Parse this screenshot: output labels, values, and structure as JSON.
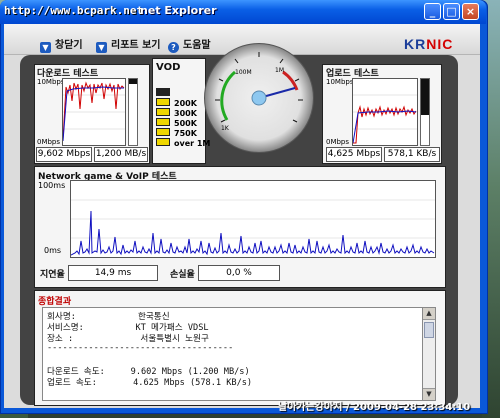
{
  "window": {
    "url_title": "http://www.bcpark.net",
    "app_title": "net Explorer",
    "minimize": "_",
    "maximize": "□",
    "close": "×"
  },
  "toolbar": {
    "close_label": "창닫기",
    "report_label": "리포트 보기",
    "help_label": "도움말",
    "brand_prefix": "KR",
    "brand_suffix": "NIC"
  },
  "download": {
    "title": "다운로드 테스트",
    "ymax": "10Mbps",
    "ymin": "0Mbps",
    "speed_mbps": "9,602 Mbps",
    "speed_mbs": "1,200 MB/s",
    "level": 0.92
  },
  "upload": {
    "title": "업로드 테스트",
    "ymax": "10Mbps",
    "ymin": "0Mbps",
    "speed_mbps": "4,625 Mbps",
    "speed_kbs": "578,1 KB/s",
    "level": 0.45
  },
  "vod": {
    "title": "VOD",
    "items": [
      "200K",
      "300K",
      "500K",
      "750K",
      "over 1M"
    ]
  },
  "gauge": {
    "labels": [
      "100M",
      "1M",
      "1K"
    ]
  },
  "network": {
    "title": "Network game & VoIP 테스트",
    "ymax": "100ms",
    "ymin": "0ms",
    "latency_label": "지연율",
    "latency_value": "14,9 ms",
    "loss_label": "손실율",
    "loss_value": "0,0 %"
  },
  "result": {
    "title": "종합결과",
    "lines": [
      "회사명:            한국통신",
      "서비스명:          KT 메가패스 VDSL",
      "장소 :             서울특별시 노원구",
      "------------------------------------",
      "",
      "다운로드 속도:     9.602 Mbps (1.200 MB/s)",
      "업로드 속도:       4.625 Mbps (578.1 KB/s)"
    ]
  },
  "status_text": "날아가는강아지 / 2009-04-28 23:34:10"
}
